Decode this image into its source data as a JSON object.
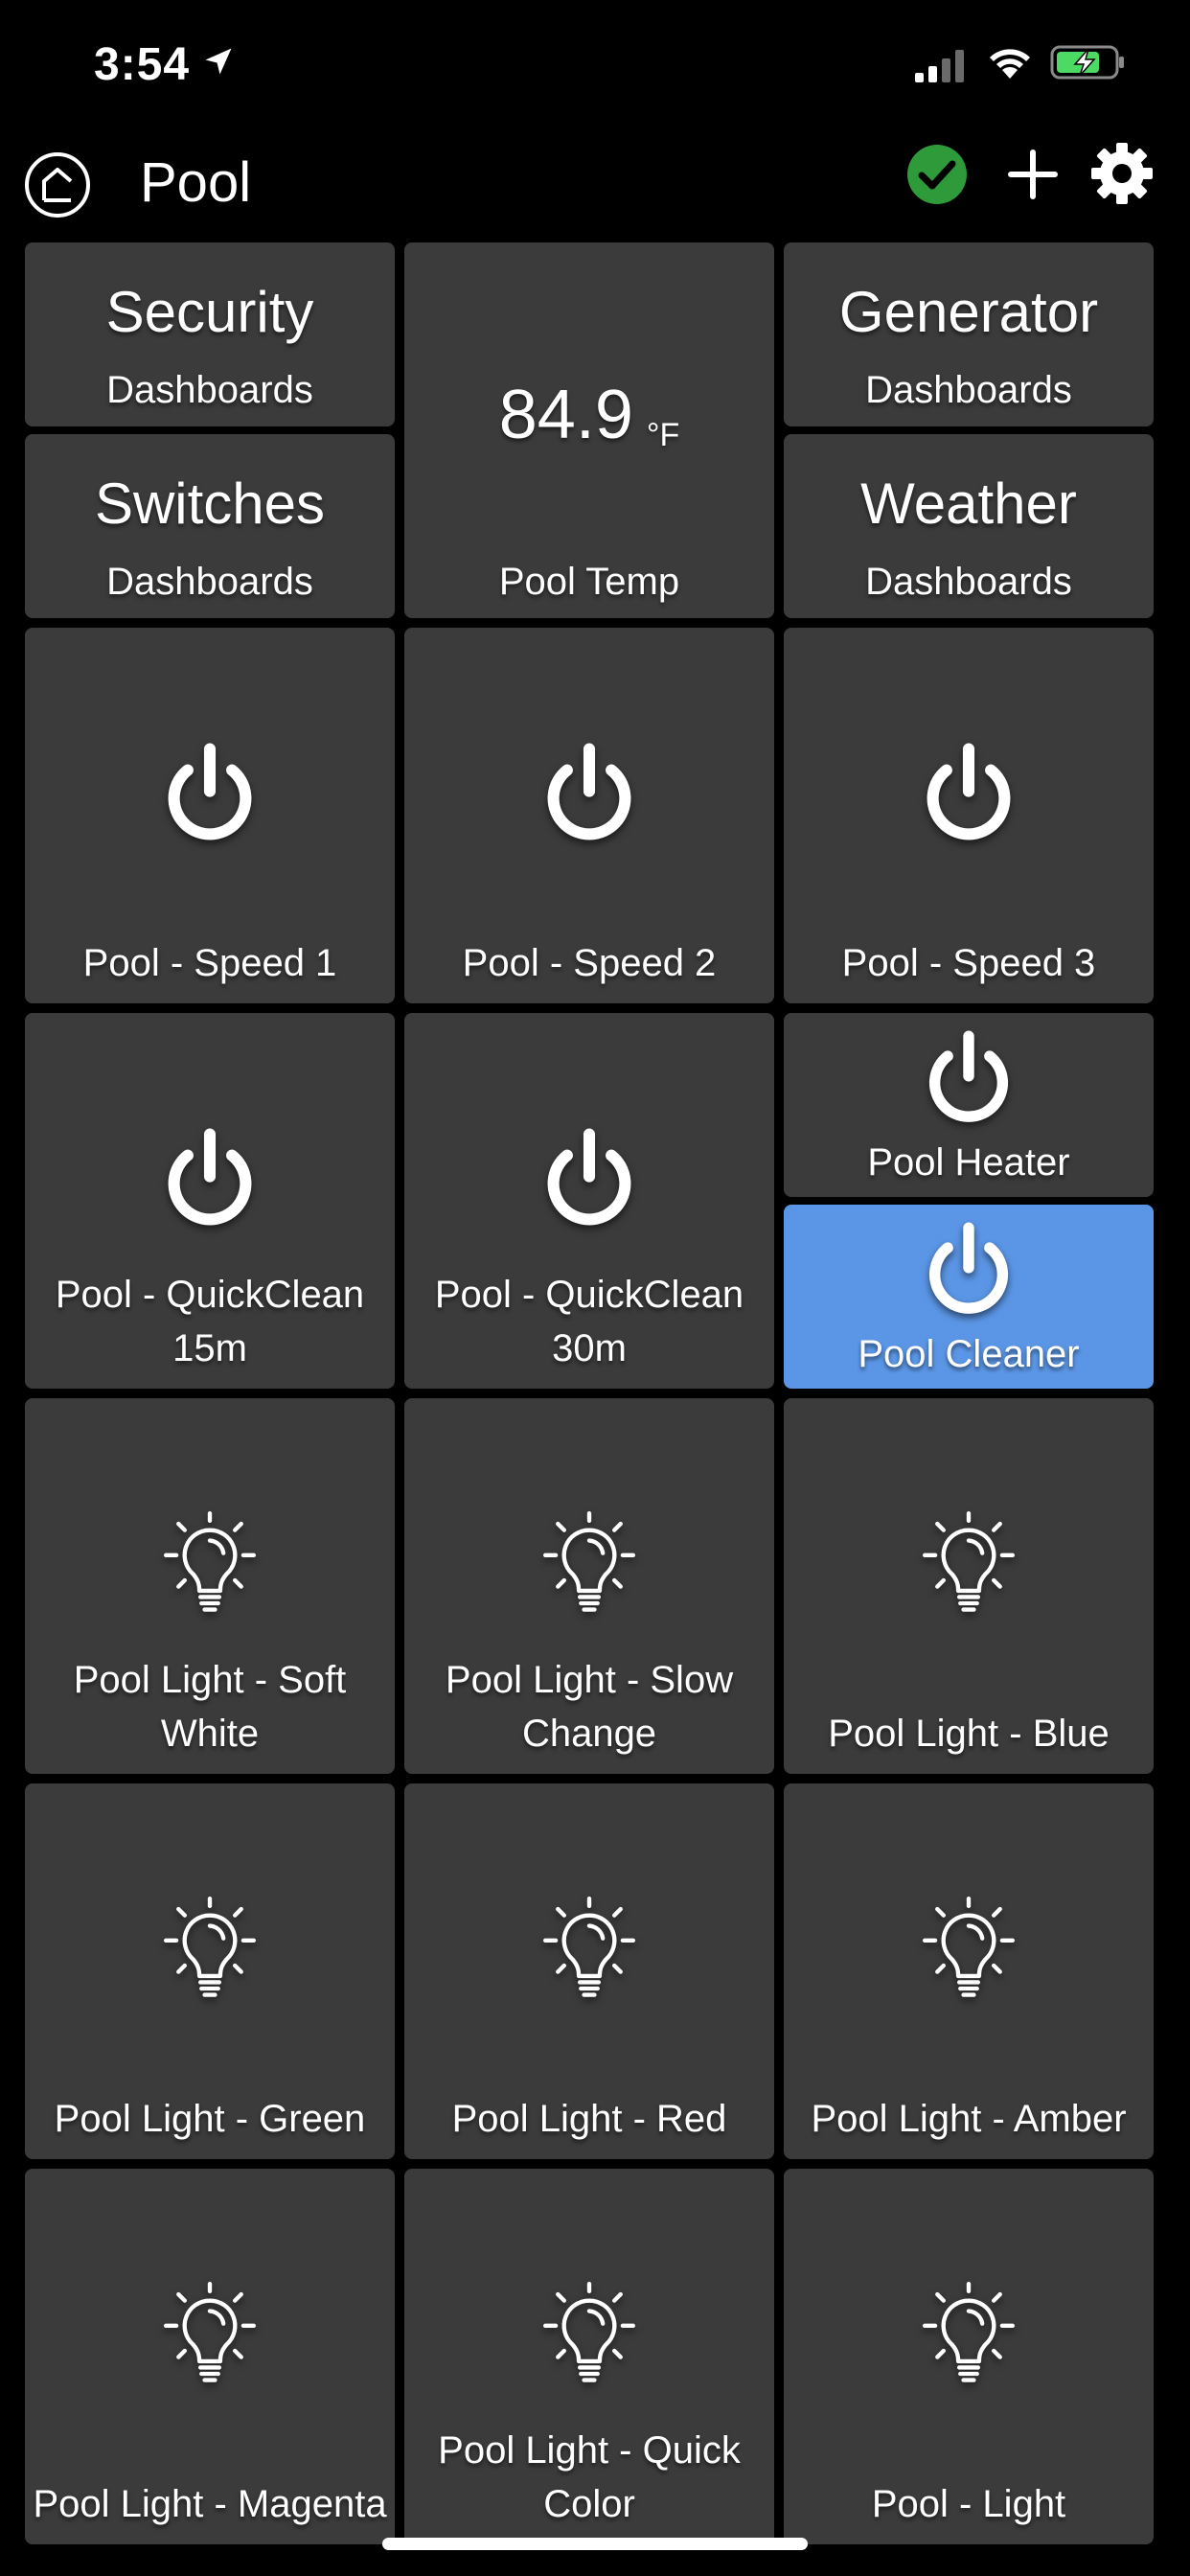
{
  "status_bar": {
    "time": "3:54"
  },
  "header": {
    "title": "Pool"
  },
  "dashboards": [
    {
      "title": "Security",
      "subtitle": "Dashboards"
    },
    {
      "title": "Generator",
      "subtitle": "Dashboards"
    },
    {
      "title": "Switches",
      "subtitle": "Dashboards"
    },
    {
      "title": "Weather",
      "subtitle": "Dashboards"
    }
  ],
  "temperature": {
    "value": "84.9",
    "unit": "°F",
    "label": "Pool Temp"
  },
  "switches": [
    {
      "label": "Pool - Speed 1"
    },
    {
      "label": "Pool - Speed 2"
    },
    {
      "label": "Pool - Speed 3"
    },
    {
      "label": "Pool - QuickClean 15m"
    },
    {
      "label": "Pool - QuickClean 30m"
    },
    {
      "label": "Pool Heater"
    },
    {
      "label": "Pool Cleaner",
      "active": true
    }
  ],
  "lights": [
    {
      "label": "Pool Light - Soft White"
    },
    {
      "label": "Pool Light - Slow Change"
    },
    {
      "label": "Pool Light - Blue"
    },
    {
      "label": "Pool Light - Green"
    },
    {
      "label": "Pool Light - Red"
    },
    {
      "label": "Pool Light - Amber"
    },
    {
      "label": "Pool Light - Magenta"
    },
    {
      "label": "Pool Light - Quick Color"
    },
    {
      "label": "Pool - Light"
    }
  ],
  "colors": {
    "background": "#000000",
    "tile": "#3b3b3b",
    "active_tile": "#5b96e6",
    "check": "#2e9a3a",
    "battery": "#4cd964"
  },
  "icons": [
    "location-arrow-icon",
    "signal-icon",
    "wifi-icon",
    "battery-charging-icon",
    "home-icon",
    "check-circle-icon",
    "plus-icon",
    "gear-icon",
    "power-icon",
    "lightbulb-icon"
  ]
}
